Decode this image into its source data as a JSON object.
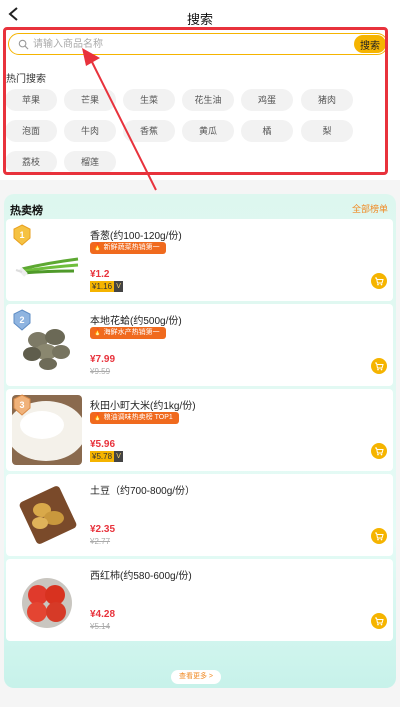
{
  "nav": {
    "title": "搜索"
  },
  "search": {
    "placeholder": "请输入商品名称",
    "button_label": "搜索"
  },
  "hot_search": {
    "title": "热门搜索",
    "items": [
      "苹果",
      "芒果",
      "生菜",
      "花生油",
      "鸡蛋",
      "猪肉",
      "泡面",
      "牛肉",
      "香蕉",
      "黄瓜",
      "橘",
      "梨",
      "荔枝",
      "榴莲"
    ]
  },
  "ranking": {
    "title": "热卖榜",
    "all_label": "全部榜单",
    "more_label": "查看更多 >",
    "products": [
      {
        "rank": "1",
        "name": "香葱(约100-120g/份)",
        "tag": "新鲜蔬菜热销第一",
        "price": "¥1.2",
        "vip_price": "¥1.16",
        "vip_badge": "V"
      },
      {
        "rank": "2",
        "name": "本地花蛤(约500g/份)",
        "tag": "海鲜水产热销第一",
        "price": "¥7.99",
        "old_price": "¥9.59"
      },
      {
        "rank": "3",
        "name": "秋田小町大米(约1kg/份)",
        "tag": "粮油调味热卖榜 TOP1",
        "price": "¥5.96",
        "vip_price": "¥5.78",
        "vip_badge": "V"
      },
      {
        "name": "土豆（约700-800g/份）",
        "price": "¥2.35",
        "old_price": "¥2.77"
      },
      {
        "name": "西红柿(约580-600g/份)",
        "price": "¥4.28",
        "old_price": "¥5.14"
      }
    ]
  },
  "colors": {
    "accent": "#f5b400",
    "price": "#e8323c",
    "tag": "#f06a1e",
    "highlight": "#e8323c"
  }
}
